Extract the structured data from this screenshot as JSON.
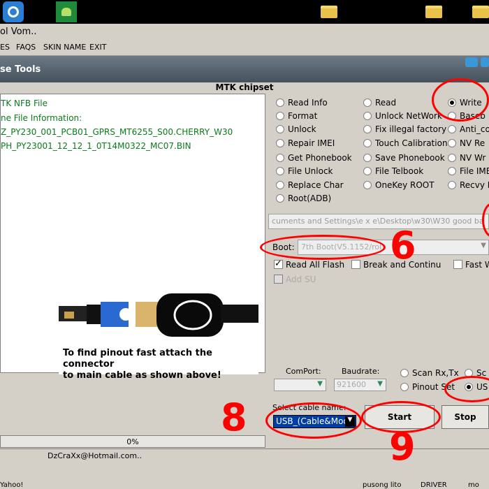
{
  "window": {
    "title": "ol Vom.."
  },
  "menu": [
    "ES",
    "FAQS",
    "SKIN NAME",
    "EXIT"
  ],
  "tools_title": "se Tools",
  "section_title": "MTK chipset",
  "log_lines": [
    "TK NFB File",
    "ne File Information:",
    "Z_PY230_001_PCB01_GPRS_MT6255_S00.CHERRY_W30",
    "PH_PY23001_12_12_1_0T14M0322_MC07.BIN"
  ],
  "options": [
    {
      "label": "Read Info",
      "selected": false
    },
    {
      "label": "Read",
      "selected": false
    },
    {
      "label": "Write",
      "selected": true
    },
    {
      "label": "Format",
      "selected": false
    },
    {
      "label": "Unlock NetWork",
      "selected": false
    },
    {
      "label": "Baseb",
      "selected": false
    },
    {
      "label": "Unlock",
      "selected": false
    },
    {
      "label": "Fix illegal factory",
      "selected": false
    },
    {
      "label": "Anti_co",
      "selected": false
    },
    {
      "label": "Repair IMEI",
      "selected": false
    },
    {
      "label": "Touch Calibration",
      "selected": false
    },
    {
      "label": "NV Re",
      "selected": false
    },
    {
      "label": "Get Phonebook",
      "selected": false
    },
    {
      "label": "Save Phonebook",
      "selected": false
    },
    {
      "label": "NV Wr",
      "selected": false
    },
    {
      "label": "File Unlock",
      "selected": false
    },
    {
      "label": "File Telbook",
      "selected": false
    },
    {
      "label": "File IME",
      "selected": false
    },
    {
      "label": "Replace Char",
      "selected": false
    },
    {
      "label": "OneKey ROOT",
      "selected": false
    },
    {
      "label": "Recvy F",
      "selected": false
    },
    {
      "label": "Root(ADB)",
      "selected": false
    }
  ],
  "file_path": "cuments and Settings\\e x e\\Desktop\\w30\\W30 good ba",
  "boot": {
    "label": "Boot:",
    "value": "7th Boot(V5.1152/rol"
  },
  "checkboxes": [
    {
      "label": "Read All Flash",
      "checked": true,
      "disabled": false
    },
    {
      "label": "Break and Continu",
      "checked": false,
      "disabled": false
    },
    {
      "label": "Fast W",
      "checked": false,
      "disabled": false
    },
    {
      "label": "Add SU",
      "checked": false,
      "disabled": true
    }
  ],
  "image_caption": [
    "To find pinout fast attach the connector",
    "to main cable as shown above!"
  ],
  "comport": {
    "label": "ComPort:",
    "value": ""
  },
  "baudrate": {
    "label": "Baudrate:",
    "value": "921600"
  },
  "port_options": [
    {
      "label": "Scan Rx,Tx",
      "selected": false
    },
    {
      "label": "Sc",
      "selected": false
    },
    {
      "label": "Pinout Set",
      "selected": false
    },
    {
      "label": "US",
      "selected": true
    }
  ],
  "cable": {
    "label": "Select cable name:",
    "value": "USB_(Cable&Mod"
  },
  "buttons": {
    "start": "Start",
    "stop": "Stop"
  },
  "progress": "0%",
  "status": {
    "email": "DzCraXx@Hotmail.com.."
  },
  "taskbar": [
    "Yahoo!",
    "pusong lito",
    "DRIVER",
    "mo"
  ],
  "annotations": [
    "6",
    "8",
    "9"
  ],
  "colors": {
    "log_text": "#0a7a1a",
    "annotation": "#ff0000",
    "cable_bg": "#003da5"
  }
}
